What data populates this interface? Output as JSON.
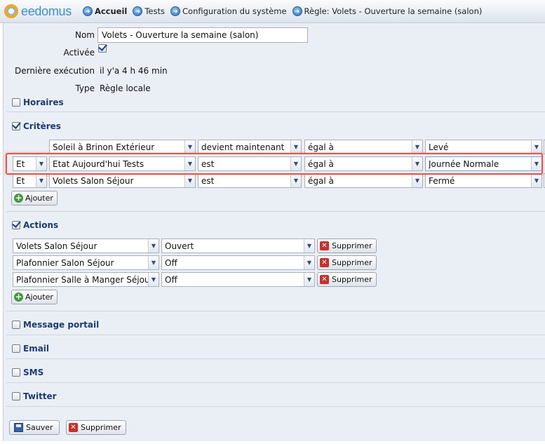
{
  "header": {
    "logo_text": "eedomus",
    "breadcrumbs": [
      {
        "label": "Accueil",
        "bold": true
      },
      {
        "label": "Tests"
      },
      {
        "label": "Configuration du système"
      },
      {
        "label": "Règle: Volets - Ouverture la semaine (salon)"
      }
    ]
  },
  "rule": {
    "name_label": "Nom",
    "name_value": "Volets - Ouverture la semaine (salon)",
    "active_label": "Activée",
    "active": true,
    "last_exec_label": "Dernière exécution",
    "last_exec_value": "il y'a 4 h 46 min",
    "type_label": "Type",
    "type_value": "Règle locale"
  },
  "sections": {
    "horaires": {
      "label": "Horaires",
      "checked": false
    },
    "criteres": {
      "label": "Critères",
      "checked": true
    },
    "actions": {
      "label": "Actions",
      "checked": true
    },
    "message_portail": {
      "label": "Message portail",
      "checked": false
    },
    "email": {
      "label": "Email",
      "checked": false
    },
    "sms": {
      "label": "SMS",
      "checked": false
    },
    "twitter": {
      "label": "Twitter",
      "checked": false
    }
  },
  "criteria": [
    {
      "conj": "",
      "device": "Soleil à Brinon Extérieur",
      "condition": "devient maintenant",
      "operator": "égal à",
      "value": "Levé"
    },
    {
      "conj": "Et",
      "device": "Etat Aujourd'hui Tests",
      "condition": "est",
      "operator": "égal à",
      "value": "Journée Normale",
      "highlighted": true
    },
    {
      "conj": "Et",
      "device": "Volets Salon Séjour",
      "condition": "est",
      "operator": "égal à",
      "value": "Fermé"
    }
  ],
  "actions": [
    {
      "device": "Volets Salon Séjour",
      "value": "Ouvert"
    },
    {
      "device": "Plafonnier Salon Séjour",
      "value": "Off"
    },
    {
      "device": "Plafonnier Salle à Manger Séjour",
      "value": "Off"
    }
  ],
  "buttons": {
    "add": "Ajouter",
    "delete": "Supprimer",
    "save": "Sauver",
    "delete_rule": "Supprimer"
  },
  "colors": {
    "accent": "#1c3b75",
    "highlight_border": "#e5574a",
    "background": "#eaeef5"
  }
}
